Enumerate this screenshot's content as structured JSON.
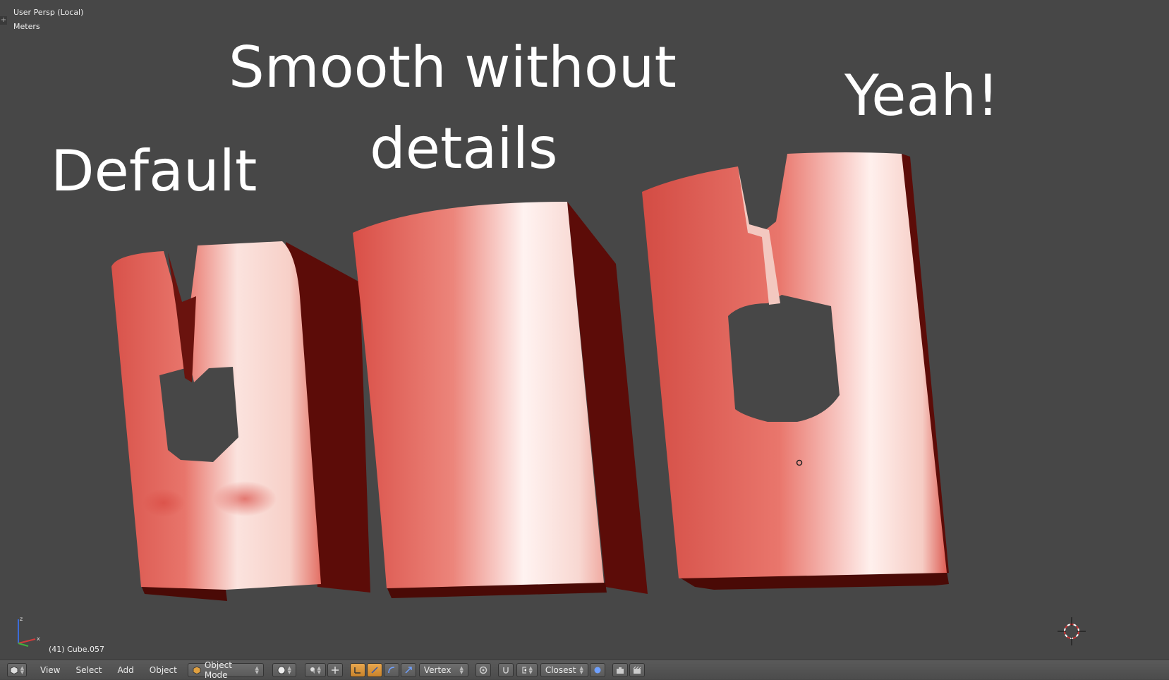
{
  "viewport": {
    "view_name": "User Persp (Local)",
    "units": "Meters",
    "object_info": "(41) Cube.057",
    "labels": {
      "default": "Default",
      "smooth_line1": "Smooth without",
      "smooth_line2": "details",
      "yeah": "Yeah!"
    },
    "colors": {
      "background": "#474747",
      "mesh": "#e0655c",
      "mesh_dark": "#5c0c08",
      "label": "#ffffff"
    }
  },
  "header": {
    "editor_type_icon": "cube-icon",
    "menus": [
      "View",
      "Select",
      "Add",
      "Object"
    ],
    "mode": "Object Mode",
    "pivot_icon": "sphere-icon",
    "snap_element": "Vertex",
    "snap_target": "Closest",
    "icons": [
      "editor-type-icon",
      "mode-cube-icon",
      "viewport-shading-icon",
      "pivot-icon",
      "manipulator-icon",
      "translate-icon",
      "rotate-icon",
      "scale-icon",
      "snap-icon",
      "proportional-icon",
      "render-icon",
      "camera-icon"
    ]
  }
}
